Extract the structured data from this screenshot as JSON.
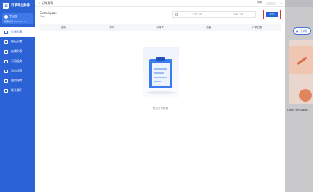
{
  "sidebar": {
    "brand": "订单导出助手",
    "account": {
      "name": "专业版",
      "expiry": "到期时间: 2024-03-14"
    },
    "items": [
      {
        "label": "订单列表",
        "active": true
      },
      {
        "label": "模板设置",
        "active": false
      },
      {
        "label": "店铺列表",
        "active": false
      },
      {
        "label": "订阅服务",
        "active": false
      },
      {
        "label": "导出设置",
        "active": false
      },
      {
        "label": "使用指南",
        "active": false
      },
      {
        "label": "联系我们",
        "active": false
      }
    ]
  },
  "main": {
    "breadcrumb": "订单列表",
    "top_right": {
      "label": "帮助"
    },
    "shop": {
      "name": "Shorniepace",
      "platform": "Etsy"
    },
    "date_range": {
      "start_placeholder": "开始日期",
      "separator": "-",
      "end_placeholder": "结束日期"
    },
    "export_label": "导出",
    "columns": [
      "图片",
      "标价",
      "订单号",
      "数量",
      "下单日期"
    ],
    "empty_text": "暂无订单数据"
  },
  "background": {
    "ext_button": "订单导",
    "pager_text": "Items per page:"
  },
  "colors": {
    "brand": "#2b62d6",
    "highlight": "#e0342c"
  }
}
